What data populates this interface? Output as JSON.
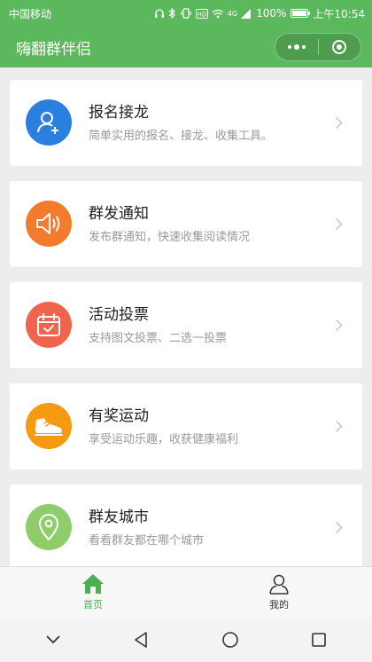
{
  "status_bar": {
    "carrier": "中国移动",
    "network": "4G",
    "battery": "100%",
    "battery_level": 1.0,
    "time": "上午10:54"
  },
  "nav": {
    "title": "嗨翻群伴侣"
  },
  "cards": [
    {
      "title": "报名接龙",
      "subtitle": "简单实用的报名、接龙、收集工具。",
      "icon": "user-add-icon",
      "color": "#2b7fe0"
    },
    {
      "title": "群发通知",
      "subtitle": "发布群通知，快速收集阅读情况",
      "icon": "speaker-icon",
      "color": "#f27b2e"
    },
    {
      "title": "活动投票",
      "subtitle": "支持图文投票、二选一投票",
      "icon": "calendar-check-icon",
      "color": "#f0644d"
    },
    {
      "title": "有奖运动",
      "subtitle": "享受运动乐趣，收获健康福利",
      "icon": "sneaker-icon",
      "color": "#f59a12"
    },
    {
      "title": "群友城市",
      "subtitle": "看看群友都在哪个城市",
      "icon": "location-pin-icon",
      "color": "#8fcc6a"
    }
  ],
  "tab_bar": {
    "home_label": "首页",
    "mine_label": "我的",
    "active_color": "#4caf50"
  }
}
